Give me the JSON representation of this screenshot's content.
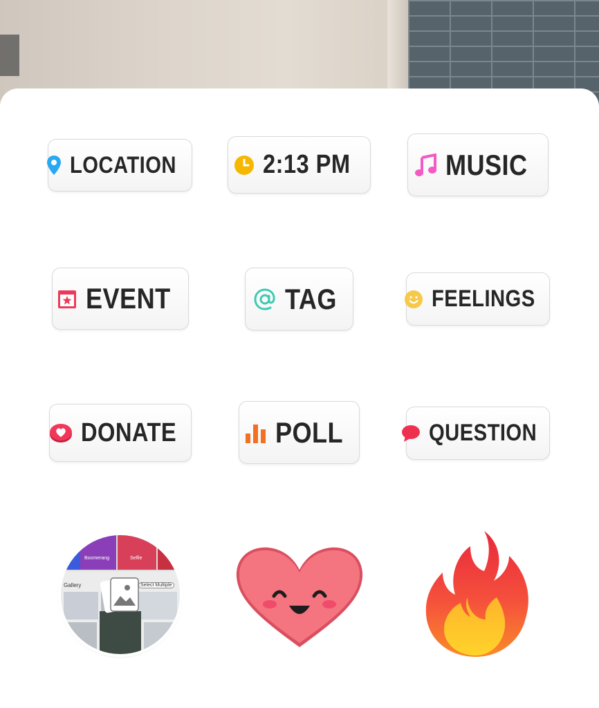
{
  "stickers_tray": {
    "chips": [
      {
        "id": "location",
        "label": "LOCATION",
        "icon": "location-pin-icon",
        "color": "#2aa8f2"
      },
      {
        "id": "time",
        "label": "2:13 PM",
        "icon": "clock-icon",
        "color": "#f6b700"
      },
      {
        "id": "music",
        "label": "MUSIC",
        "icon": "music-note-icon",
        "color": "#f25ac4"
      },
      {
        "id": "event",
        "label": "EVENT",
        "icon": "calendar-star-icon",
        "color": "#ed3a5a"
      },
      {
        "id": "tag",
        "label": "TAG",
        "icon": "at-sign-icon",
        "color": "#3ec9b1"
      },
      {
        "id": "feelings",
        "label": "FEELINGS",
        "icon": "smiley-icon",
        "color": "#f7c948"
      },
      {
        "id": "donate",
        "label": "DONATE",
        "icon": "heart-coin-icon",
        "color": "#f0395a"
      },
      {
        "id": "poll",
        "label": "POLL",
        "icon": "bar-chart-icon",
        "color": "#f36f21"
      },
      {
        "id": "question",
        "label": "QUESTION",
        "icon": "speech-bubble-icon",
        "color": "#ef3150"
      }
    ],
    "gallery_preview": {
      "tile_labels": [
        "Boomerang",
        "Selfie"
      ],
      "gallery_label": "Gallery",
      "select_label": "Select Multiple"
    }
  }
}
